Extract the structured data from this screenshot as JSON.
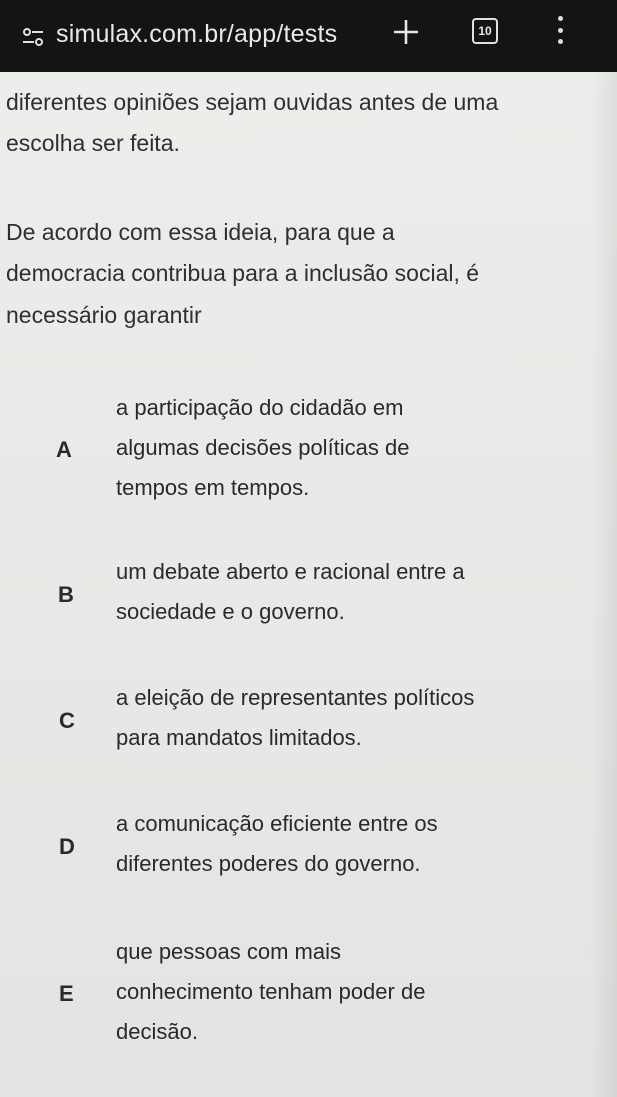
{
  "browser": {
    "url": "simulax.com.br/app/tests",
    "tab_count": "10",
    "new_tab_icon": "plus-icon",
    "site_icon": "tune-icon",
    "menu_icon": "more-vert-icon"
  },
  "question": {
    "line1": "diferentes opiniões sejam ouvidas antes de uma",
    "line2": "escolha ser feita.",
    "prompt1": "De acordo com essa ideia, para que a",
    "prompt2": "democracia contribua para a inclusão social, é",
    "prompt3": "necessário garantir"
  },
  "options": [
    {
      "letter": "A",
      "l1": "a participação do cidadão em",
      "l2": "algumas decisões políticas de",
      "l3": "tempos em tempos."
    },
    {
      "letter": "B",
      "l1": "um debate aberto e racional entre a",
      "l2": "sociedade e o governo."
    },
    {
      "letter": "C",
      "l1": "a eleição de representantes políticos",
      "l2": "para mandatos limitados."
    },
    {
      "letter": "D",
      "l1": "a comunicação eficiente entre os",
      "l2": "diferentes poderes do governo."
    },
    {
      "letter": "E",
      "l1": "que pessoas com mais",
      "l2": "conhecimento tenham poder de",
      "l3": "decisão."
    }
  ]
}
